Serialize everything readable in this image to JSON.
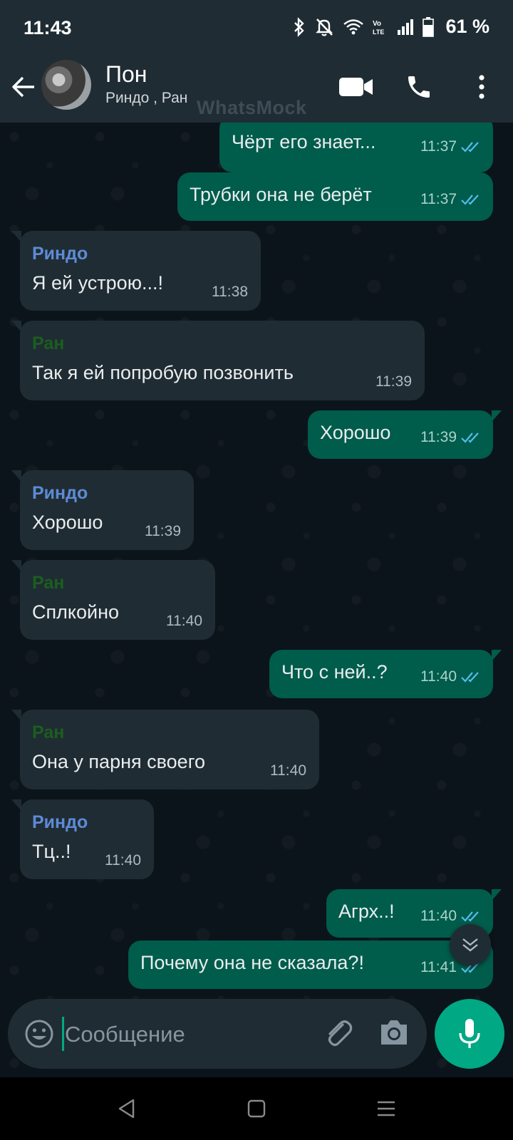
{
  "status_bar": {
    "time": "11:43",
    "battery": "61 %",
    "icons": [
      "bluetooth-icon",
      "bell-off-icon",
      "wifi-icon",
      "volte-icon",
      "signal-icon",
      "battery-icon"
    ]
  },
  "header": {
    "chat_name": "Пон",
    "participants": "Риндо , Ран",
    "watermark": "WhatsMock",
    "icons": [
      "back-arrow-icon",
      "video-call-icon",
      "phone-icon",
      "more-vert-icon"
    ]
  },
  "colors": {
    "outgoing_bubble": "#005c4b",
    "incoming_bubble": "#202c33",
    "background": "#0b141a",
    "header": "#1f2c34",
    "accent": "#00a884",
    "read_tick": "#53bdeb",
    "sender_rindo": "#5d8bd6",
    "sender_ran": "#1b5e20"
  },
  "messages": [
    {
      "dir": "out",
      "text": "Чёрт его знает...",
      "time": "11:37",
      "status": "read"
    },
    {
      "dir": "out",
      "text": "Трубки она не берёт",
      "time": "11:37",
      "status": "read"
    },
    {
      "dir": "in",
      "sender": "Риндо",
      "text": "Я ей устрою...!",
      "time": "11:38"
    },
    {
      "dir": "in",
      "sender": "Ран",
      "text": "Так я ей попробую позвонить",
      "time": "11:39"
    },
    {
      "dir": "out",
      "text": "Хорошо",
      "time": "11:39",
      "status": "read"
    },
    {
      "dir": "in",
      "sender": "Риндо",
      "text": "Хорошо",
      "time": "11:39"
    },
    {
      "dir": "in",
      "sender": "Ран",
      "text": "Сплкойно",
      "time": "11:40"
    },
    {
      "dir": "out",
      "text": "Что с ней..?",
      "time": "11:40",
      "status": "read"
    },
    {
      "dir": "in",
      "sender": "Ран",
      "text": "Она у парня своего",
      "time": "11:40"
    },
    {
      "dir": "in",
      "sender": "Риндо",
      "text": "Тц..!",
      "time": "11:40"
    },
    {
      "dir": "out",
      "text": "Агрх..!",
      "time": "11:40",
      "status": "read"
    },
    {
      "dir": "out",
      "text": "Почему она не сказала?!",
      "time": "11:41",
      "status": "read"
    }
  ],
  "composer": {
    "placeholder": "Сообщение",
    "icons": [
      "emoji-icon",
      "attach-icon",
      "camera-icon",
      "mic-icon"
    ]
  },
  "nav_bar": {
    "icons": [
      "nav-back-icon",
      "nav-home-icon",
      "nav-recents-icon"
    ]
  }
}
